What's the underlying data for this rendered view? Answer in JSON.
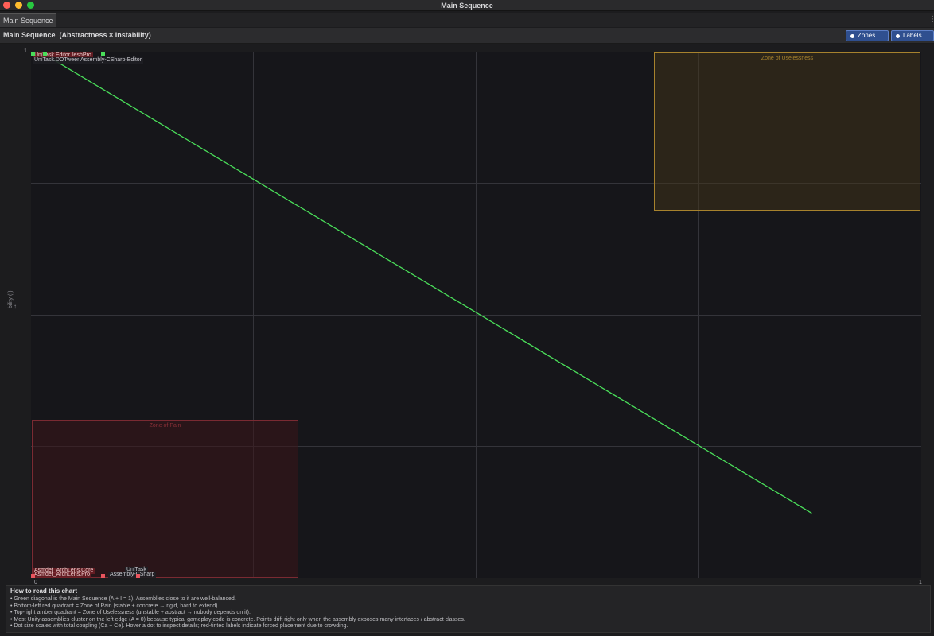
{
  "window": {
    "title": "Main Sequence"
  },
  "tab": {
    "label": "Main Sequence"
  },
  "toolbar": {
    "heading": "Main Sequence  (Abstractness × Instability)",
    "zones_label": "Zones",
    "labels_label": "Labels"
  },
  "chart": {
    "y_axis_label": "bility (I)",
    "y_tick_top": "1",
    "x_tick_left": "0",
    "x_tick_right": "1",
    "zones": {
      "uselessness": "Zone of Uselessness",
      "pain": "Zone of Pain"
    },
    "assembly_labels": {
      "unitask_editor": "UniTask.Editor",
      "meshpro": "leshPro",
      "unitask_dotween": "UniTask.DOTween",
      "assembly_csharp_editor": "Assembly-CSharp-Editor",
      "archlens_core": "Asmdef_ArchLens.Core",
      "archlens_pro": "Asmdef_ArchLens.Pro",
      "unitask": "UniTask",
      "assembly_csharp": "Assembly-CSharp"
    }
  },
  "chart_data": {
    "type": "scatter",
    "xlabel": "",
    "ylabel": "bility (I)",
    "xlim": [
      0,
      1
    ],
    "ylim": [
      0,
      1
    ],
    "grid": true,
    "main_sequence": {
      "from": [
        0.02,
        0.99
      ],
      "to": [
        0.877,
        0.123
      ],
      "color": "#4ade5a"
    },
    "zones": [
      {
        "name": "Zone of Uselessness",
        "x": [
          0.7,
          1.0
        ],
        "y": [
          0.7,
          1.0
        ],
        "color": "#a7822d"
      },
      {
        "name": "Zone of Pain",
        "x": [
          0.0,
          0.3
        ],
        "y": [
          0.0,
          0.3
        ],
        "color": "#7a2a32"
      }
    ],
    "points": [
      {
        "name": "UniTask.Editor",
        "x": 0.0,
        "y": 1.0,
        "color": "#4ade5a"
      },
      {
        "name": "UniTask.DOTween",
        "x": 0.015,
        "y": 1.0,
        "color": "#4ade5a"
      },
      {
        "name": "Assembly-CSharp-Editor",
        "x": 0.08,
        "y": 1.0,
        "color": "#4ade5a"
      },
      {
        "name": "Asmdef_ArchLens.Core",
        "x": 0.0,
        "y": 0.0,
        "color": "#e8555e"
      },
      {
        "name": "Asmdef_ArchLens.Pro",
        "x": 0.08,
        "y": 0.0,
        "color": "#e8555e"
      },
      {
        "name": "UniTask",
        "x": 0.12,
        "y": 0.0,
        "color": "#e8555e"
      },
      {
        "name": "Assembly-CSharp",
        "x": 0.12,
        "y": 0.0,
        "color": "#e8555e"
      }
    ]
  },
  "help": {
    "title": "How to read this chart",
    "lines": [
      "• Green diagonal is the Main Sequence  (A + I = 1). Assemblies close to it are well-balanced.",
      "• Bottom-left red quadrant = Zone of Pain  (stable + concrete → rigid, hard to extend).",
      "• Top-right amber quadrant = Zone of Uselessness  (unstable + abstract → nobody depends on it).",
      "• Most Unity assemblies cluster on the left edge (A = 0) because typical gameplay code is concrete. Points drift right only when the assembly exposes many interfaces / abstract classes.",
      "• Dot size scales with total coupling (Ca + Ce). Hover a dot to inspect details; red-tinted labels indicate forced placement due to crowding."
    ]
  }
}
